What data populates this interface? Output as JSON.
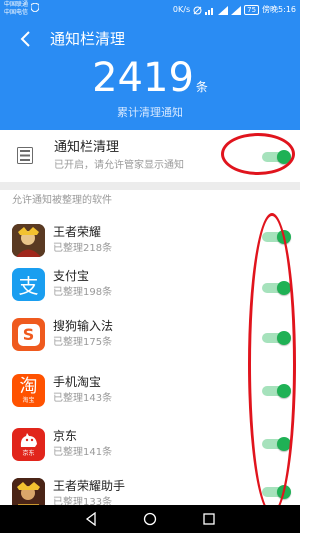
{
  "status_bar": {
    "carrier_1": "中国联通",
    "carrier_2": "中国电信",
    "speed": "0K/s",
    "battery": "75",
    "time_label": "傍晚5:16"
  },
  "header": {
    "title": "通知栏清理",
    "count": "2419",
    "count_unit": "条",
    "subtitle": "累计清理通知"
  },
  "master_setting": {
    "title": "通知栏清理",
    "subtitle": "已开启，请允许管家显示通知",
    "enabled": true
  },
  "section_label": "允许通知被整理的软件",
  "apps": [
    {
      "name": "王者荣耀",
      "count": "已整理218条",
      "icon": "honor-of-kings-icon",
      "enabled": true
    },
    {
      "name": "支付宝",
      "count": "已整理198条",
      "icon": "alipay-icon",
      "enabled": true
    },
    {
      "name": "搜狗输入法",
      "count": "已整理175条",
      "icon": "sogou-input-icon",
      "enabled": true
    },
    {
      "name": "手机淘宝",
      "count": "已整理143条",
      "icon": "taobao-icon",
      "enabled": true
    },
    {
      "name": "京东",
      "count": "已整理141条",
      "icon": "jd-icon",
      "enabled": true
    },
    {
      "name": "王者荣耀助手",
      "count": "已整理133条",
      "icon": "honor-of-kings-helper-icon",
      "enabled": true
    }
  ],
  "icon_glyphs": {
    "alipay": "支",
    "sogou": "S",
    "taobao": "淘",
    "taobao_small": "淘宝",
    "jd_small": "京东"
  },
  "colors": {
    "primary_blue": "#2a8cf3",
    "toggle_green": "#1fb155",
    "annotation_red": "#e0141d"
  }
}
